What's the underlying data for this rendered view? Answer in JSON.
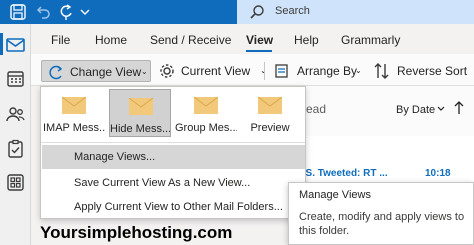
{
  "titlebar": {
    "search_placeholder": "Search"
  },
  "rail": {
    "items": [
      "mail-icon",
      "calendar-icon",
      "people-icon",
      "tasks-icon",
      "apps-icon"
    ],
    "active": "mail-icon"
  },
  "ribbon_tabs": [
    {
      "label": "File"
    },
    {
      "label": "Home"
    },
    {
      "label": "Send / Receive"
    },
    {
      "label": "View"
    },
    {
      "label": "Help"
    },
    {
      "label": "Grammarly"
    }
  ],
  "active_tab": "View",
  "commands": {
    "change_view": "Change View",
    "current_view": "Current View",
    "arrange_by": "Arrange By",
    "reverse_sort": "Reverse Sort"
  },
  "view_gallery": [
    {
      "label": "IMAP Mess..."
    },
    {
      "label": "Hide Mess..."
    },
    {
      "label": "Group Mes..."
    },
    {
      "label": "Preview"
    }
  ],
  "selected_view": "Hide Mess...",
  "menu": {
    "manage_views": "Manage Views...",
    "save_view": "Save Current View As a New View...",
    "apply_view": "Apply Current View to Other Mail Folders..."
  },
  "mail_list": {
    "header_fragment": "ead",
    "sort_label": "By Date",
    "item_subject": "I.S. Tweeted: RT ...",
    "item_time": "10:18"
  },
  "tooltip": {
    "title": "Manage Views",
    "body": "Create, modify and apply views to this folder."
  },
  "watermark": "Yoursimplehosting.com",
  "colors": {
    "accent": "#0f6cbd",
    "envelope": "#f2c97a"
  }
}
